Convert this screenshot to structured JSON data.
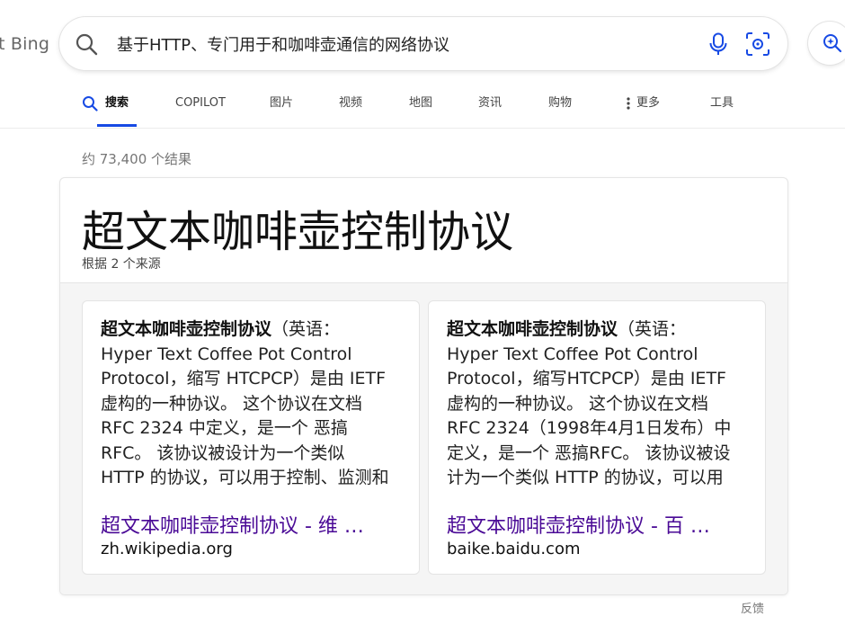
{
  "header": {
    "logo_fragment": "t Bing",
    "search_query": "基于HTTP、专门用于和咖啡壶通信的网络协议"
  },
  "tabs": [
    {
      "label": "搜索"
    },
    {
      "label": "COPILOT"
    },
    {
      "label": "图片"
    },
    {
      "label": "视频"
    },
    {
      "label": "地图"
    },
    {
      "label": "资讯"
    },
    {
      "label": "购物"
    },
    {
      "label": "更多"
    },
    {
      "label": "工具"
    }
  ],
  "results": {
    "count": "约 73,400 个结果"
  },
  "answer": {
    "title": "超文本咖啡壶控制协议",
    "subtitle": "根据 2 个来源",
    "sources": [
      {
        "bold": "超文本咖啡壶控制协议",
        "text": "（英语：Hyper Text Coffee Pot Control Protocol，缩写 HTCPCP）是由 IETF 虚构的一种协议。 这个协议在文档 RFC 2324 中定义，是一个 恶搞RFC。 该协议被设计为一个类似 HTTP 的协议，可以用于控制、监测和诊断 咖…",
        "link": "超文本咖啡壶控制协议 - 维 …",
        "domain": "zh.wikipedia.org"
      },
      {
        "bold": "超文本咖啡壶控制协议",
        "text": "（英语：Hyper Text Coffee Pot Control Protocol，缩写HTCPCP）是由 IETF 虚构的一种协议。 这个协议在文档RFC 2324（1998年4月1日发布）中定义，是一个 恶搞RFC。 该协议被设计为一个类似 HTTP 的协议，可以用于控制、…",
        "link": "超文本咖啡壶控制协议 - 百 …",
        "domain": "baike.baidu.com"
      }
    ]
  },
  "footer": {
    "feedback": "反馈"
  },
  "colors": {
    "accent": "#174ae4",
    "link": "#4a0a96"
  }
}
